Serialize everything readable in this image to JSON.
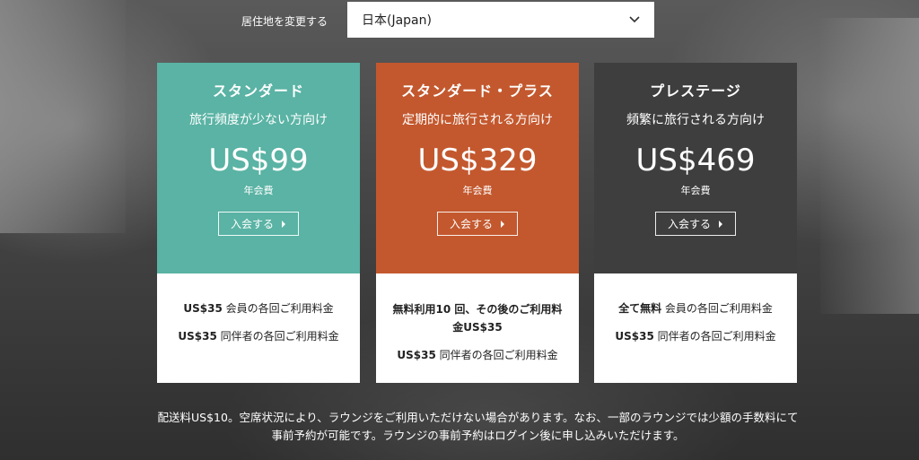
{
  "residence": {
    "label": "居住地を変更する",
    "selected": "日本(Japan)"
  },
  "plans": [
    {
      "name": "スタンダード",
      "subtitle": "旅行頻度が少ない方向け",
      "price": "US$99",
      "fee_label": "年会費",
      "join_label": "入会する",
      "color": "#5ab3a4",
      "benefits": [
        {
          "bold": "US$35",
          "text": " 会員の各回ご利用料金"
        },
        {
          "bold": "US$35",
          "text": " 同伴者の各回ご利用料金"
        }
      ]
    },
    {
      "name": "スタンダード・プラス",
      "subtitle": "定期的に旅行される方向け",
      "price": "US$329",
      "fee_label": "年会費",
      "join_label": "入会する",
      "color": "#c3582e",
      "benefits": [
        {
          "bold": "無料利用10 回、その後のご利用料金US$35",
          "text": ""
        },
        {
          "bold": "US$35",
          "text": " 同伴者の各回ご利用料金"
        }
      ]
    },
    {
      "name": "プレステージ",
      "subtitle": "頻繁に旅行される方向け",
      "price": "US$469",
      "fee_label": "年会費",
      "join_label": "入会する",
      "color": "#3e3e3e",
      "benefits": [
        {
          "bold": "全て無料",
          "text": " 会員の各回ご利用料金"
        },
        {
          "bold": "US$35",
          "text": " 同伴者の各回ご利用料金"
        }
      ]
    }
  ],
  "footnote": "配送料US$10。空席状況により、ラウンジをご利用いただけない場合があります。なお、一部のラウンジでは少額の手数料にて事前予約が可能です。ラウンジの事前予約はログイン後に申し込みいただけます。",
  "icons": {
    "dropdown": "chevron-down-icon",
    "join_arrow": "caret-right-icon"
  }
}
